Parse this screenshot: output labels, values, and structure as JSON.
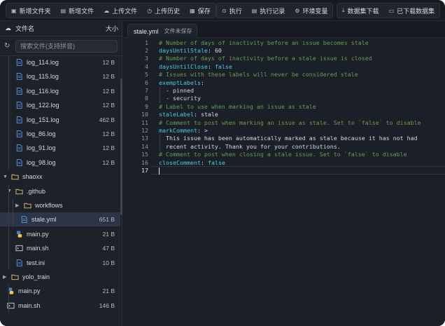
{
  "toolbar": {
    "groups": [
      [
        {
          "icon": "folder-plus-icon",
          "glyph": "▣",
          "label": "新增文件夹"
        },
        {
          "icon": "file-plus-icon",
          "glyph": "▤",
          "label": "新增文件"
        },
        {
          "icon": "cloud-upload-icon",
          "glyph": "☁",
          "label": "上传文件"
        },
        {
          "icon": "history-icon",
          "glyph": "◷",
          "label": "上传历史"
        },
        {
          "icon": "save-icon",
          "glyph": "▦",
          "label": "保存"
        }
      ],
      [
        {
          "icon": "play-icon",
          "glyph": "⊙",
          "label": "执行"
        },
        {
          "icon": "log-icon",
          "glyph": "▤",
          "label": "执行记录"
        },
        {
          "icon": "settings-icon",
          "glyph": "⚙",
          "label": "环境变量"
        }
      ],
      [
        {
          "icon": "download-icon",
          "glyph": "⤓",
          "label": "数据集下载"
        },
        {
          "icon": "folder-download-icon",
          "glyph": "▭",
          "label": "已下载数据集"
        }
      ]
    ]
  },
  "sidebar": {
    "header_title": "文件名",
    "header_size": "大小",
    "search_placeholder": "搜索文件(支持拼音)",
    "tree": [
      {
        "type": "file",
        "kind": "text",
        "name": "log_114.log",
        "size": "12 B",
        "depth": 2
      },
      {
        "type": "file",
        "kind": "text",
        "name": "log_115.log",
        "size": "12 B",
        "depth": 2
      },
      {
        "type": "file",
        "kind": "text",
        "name": "log_116.log",
        "size": "12 B",
        "depth": 2
      },
      {
        "type": "file",
        "kind": "text",
        "name": "log_122.log",
        "size": "12 B",
        "depth": 2
      },
      {
        "type": "file",
        "kind": "text",
        "name": "log_151.log",
        "size": "462 B",
        "depth": 2
      },
      {
        "type": "file",
        "kind": "text",
        "name": "log_86.log",
        "size": "12 B",
        "depth": 2
      },
      {
        "type": "file",
        "kind": "text",
        "name": "log_91.log",
        "size": "12 B",
        "depth": 2
      },
      {
        "type": "file",
        "kind": "text",
        "name": "log_98.log",
        "size": "12 B",
        "depth": 2
      },
      {
        "type": "folder",
        "name": "shaoxx",
        "size": "",
        "depth": 0,
        "open": true
      },
      {
        "type": "folder",
        "name": ".github",
        "size": "",
        "depth": 1,
        "open": true
      },
      {
        "type": "folder",
        "name": "workflows",
        "size": "",
        "depth": 2,
        "open": false
      },
      {
        "type": "file",
        "kind": "text",
        "name": "stale.yml",
        "size": "651 B",
        "depth": 3,
        "selected": true
      },
      {
        "type": "file",
        "kind": "python",
        "name": "main.py",
        "size": "21 B",
        "depth": 2
      },
      {
        "type": "file",
        "kind": "shell",
        "name": "main.sh",
        "size": "47 B",
        "depth": 2
      },
      {
        "type": "file",
        "kind": "text",
        "name": "test.ini",
        "size": "10 B",
        "depth": 2
      },
      {
        "type": "folder",
        "name": "yolo_train",
        "size": "",
        "depth": 0,
        "open": false
      },
      {
        "type": "file",
        "kind": "python",
        "name": "main.py",
        "size": "21 B",
        "depth": 1
      },
      {
        "type": "file",
        "kind": "shell",
        "name": "main.sh",
        "size": "146 B",
        "depth": 1
      }
    ]
  },
  "editor": {
    "tab_name": "stale.yml",
    "tab_status": "文件未保存",
    "active_line": 17,
    "lines": [
      [
        {
          "t": "# Number of days of inactivity before an issue becomes stale",
          "c": "cm"
        }
      ],
      [
        {
          "t": "daysUntilStale",
          "c": "key"
        },
        {
          "t": ": ",
          "c": "str"
        },
        {
          "t": "60",
          "c": "num"
        }
      ],
      [
        {
          "t": "# Number of days of inactivity before a stale issue is closed",
          "c": "cm"
        }
      ],
      [
        {
          "t": "daysUntilClose",
          "c": "key"
        },
        {
          "t": ": ",
          "c": "str"
        },
        {
          "t": "false",
          "c": "bool"
        }
      ],
      [
        {
          "t": "# Issues with these labels will never be considered stale",
          "c": "cm"
        }
      ],
      [
        {
          "t": "exemptLabels",
          "c": "key"
        },
        {
          "t": ":",
          "c": "str"
        }
      ],
      [
        {
          "t": "  - pinned",
          "c": "dash"
        }
      ],
      [
        {
          "t": "  - security",
          "c": "dash"
        }
      ],
      [
        {
          "t": "# Label to use when marking an issue as stale",
          "c": "cm"
        }
      ],
      [
        {
          "t": "staleLabel",
          "c": "key"
        },
        {
          "t": ": stale",
          "c": "str"
        }
      ],
      [
        {
          "t": "# Comment to post when marking an issue as stale. Set to `false` to disable",
          "c": "cm"
        }
      ],
      [
        {
          "t": "markComment",
          "c": "key"
        },
        {
          "t": ": >",
          "c": "str"
        }
      ],
      [
        {
          "t": "  This issue has been automatically marked as stale because it has not had",
          "c": "str"
        }
      ],
      [
        {
          "t": "  recent activity. Thank you for your contributions.",
          "c": "str"
        }
      ],
      [
        {
          "t": "# Comment to post when closing a stale issue. Set to `false` to disable",
          "c": "cm"
        }
      ],
      [
        {
          "t": "closeComment",
          "c": "key"
        },
        {
          "t": ": ",
          "c": "str"
        },
        {
          "t": "false",
          "c": "bool"
        }
      ],
      []
    ]
  }
}
